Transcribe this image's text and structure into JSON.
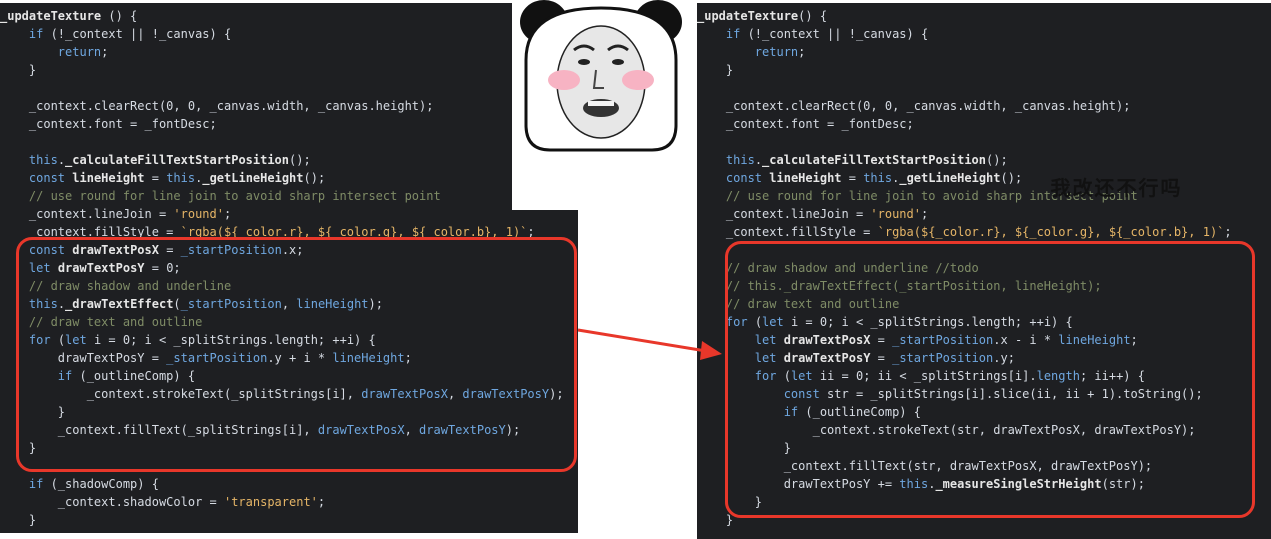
{
  "left_code": {
    "lines": [
      [
        [
          "fn",
          "_updateTexture"
        ],
        [
          "plain",
          " () {"
        ]
      ],
      [
        [
          "plain",
          "    "
        ],
        [
          "kw",
          "if"
        ],
        [
          "plain",
          " (!_context || !_canvas) {"
        ]
      ],
      [
        [
          "plain",
          "        "
        ],
        [
          "kw",
          "return"
        ],
        [
          "plain",
          ";"
        ]
      ],
      [
        [
          "plain",
          "    }"
        ]
      ],
      [
        [
          "plain",
          ""
        ]
      ],
      [
        [
          "plain",
          "    _context.clearRect(0, 0, _canvas.width, _canvas.height);"
        ]
      ],
      [
        [
          "plain",
          "    _context.font = _fontDesc;"
        ]
      ],
      [
        [
          "plain",
          ""
        ]
      ],
      [
        [
          "plain",
          "    "
        ],
        [
          "this",
          "this"
        ],
        [
          "plain",
          "."
        ],
        [
          "fn",
          "_calculateFillTextStartPosition"
        ],
        [
          "plain",
          "();"
        ]
      ],
      [
        [
          "plain",
          "    "
        ],
        [
          "kw",
          "const"
        ],
        [
          "plain",
          " "
        ],
        [
          "fn",
          "lineHeight"
        ],
        [
          "plain",
          " = "
        ],
        [
          "this",
          "this"
        ],
        [
          "plain",
          "."
        ],
        [
          "fn",
          "_getLineHeight"
        ],
        [
          "plain",
          "();"
        ]
      ],
      [
        [
          "cmt",
          "    // use round for line join to avoid sharp intersect point"
        ]
      ],
      [
        [
          "plain",
          "    _context.lineJoin = "
        ],
        [
          "str",
          "'round'"
        ],
        [
          "plain",
          ";"
        ]
      ],
      [
        [
          "plain",
          "    _context.fillStyle = "
        ],
        [
          "str",
          "`rgba(${_color.r}, ${_color.g}, ${_color.b}, 1)`"
        ],
        [
          "plain",
          ";"
        ]
      ],
      [
        [
          "plain",
          "    "
        ],
        [
          "kw",
          "const"
        ],
        [
          "plain",
          " "
        ],
        [
          "fn",
          "drawTextPosX"
        ],
        [
          "plain",
          " = "
        ],
        [
          "kw",
          "_startPosition"
        ],
        [
          "plain",
          ".x;"
        ]
      ],
      [
        [
          "plain",
          "    "
        ],
        [
          "kw",
          "let"
        ],
        [
          "plain",
          " "
        ],
        [
          "fn",
          "drawTextPosY"
        ],
        [
          "plain",
          " = 0;"
        ]
      ],
      [
        [
          "cmt",
          "    // draw shadow and underline"
        ]
      ],
      [
        [
          "plain",
          "    "
        ],
        [
          "this",
          "this"
        ],
        [
          "plain",
          "."
        ],
        [
          "fn",
          "_drawTextEffect"
        ],
        [
          "plain",
          "("
        ],
        [
          "kw",
          "_startPosition"
        ],
        [
          "plain",
          ", "
        ],
        [
          "kw",
          "lineHeight"
        ],
        [
          "plain",
          ");"
        ]
      ],
      [
        [
          "cmt",
          "    // draw text and outline"
        ]
      ],
      [
        [
          "plain",
          "    "
        ],
        [
          "kw",
          "for"
        ],
        [
          "plain",
          " ("
        ],
        [
          "kw",
          "let"
        ],
        [
          "plain",
          " i = 0; i < _splitStrings.length; ++i) {"
        ]
      ],
      [
        [
          "plain",
          "        drawTextPosY = "
        ],
        [
          "kw",
          "_startPosition"
        ],
        [
          "plain",
          ".y + i * "
        ],
        [
          "kw",
          "lineHeight"
        ],
        [
          "plain",
          ";"
        ]
      ],
      [
        [
          "plain",
          "        "
        ],
        [
          "kw",
          "if"
        ],
        [
          "plain",
          " (_outlineComp) {"
        ]
      ],
      [
        [
          "plain",
          "            _context.strokeText(_splitStrings[i], "
        ],
        [
          "kw",
          "drawTextPosX"
        ],
        [
          "plain",
          ", "
        ],
        [
          "kw",
          "drawTextPosY"
        ],
        [
          "plain",
          ");"
        ]
      ],
      [
        [
          "plain",
          "        }"
        ]
      ],
      [
        [
          "plain",
          "        _context.fillText(_splitStrings[i], "
        ],
        [
          "kw",
          "drawTextPosX"
        ],
        [
          "plain",
          ", "
        ],
        [
          "kw",
          "drawTextPosY"
        ],
        [
          "plain",
          ");"
        ]
      ],
      [
        [
          "plain",
          "    }"
        ]
      ],
      [
        [
          "plain",
          ""
        ]
      ],
      [
        [
          "plain",
          "    "
        ],
        [
          "kw",
          "if"
        ],
        [
          "plain",
          " (_shadowComp) {"
        ]
      ],
      [
        [
          "plain",
          "        _context.shadowColor = "
        ],
        [
          "str",
          "'transparent'"
        ],
        [
          "plain",
          ";"
        ]
      ],
      [
        [
          "plain",
          "    }"
        ]
      ]
    ]
  },
  "right_code": {
    "lines": [
      [
        [
          "fn",
          "_updateTexture"
        ],
        [
          "plain",
          "() {"
        ]
      ],
      [
        [
          "plain",
          "    "
        ],
        [
          "kw",
          "if"
        ],
        [
          "plain",
          " (!_context || !_canvas) {"
        ]
      ],
      [
        [
          "plain",
          "        "
        ],
        [
          "kw",
          "return"
        ],
        [
          "plain",
          ";"
        ]
      ],
      [
        [
          "plain",
          "    }"
        ]
      ],
      [
        [
          "plain",
          ""
        ]
      ],
      [
        [
          "plain",
          "    _context.clearRect(0, 0, _canvas.width, _canvas.height);"
        ]
      ],
      [
        [
          "plain",
          "    _context.font = _fontDesc;"
        ]
      ],
      [
        [
          "plain",
          ""
        ]
      ],
      [
        [
          "plain",
          "    "
        ],
        [
          "this",
          "this"
        ],
        [
          "plain",
          "."
        ],
        [
          "fn",
          "_calculateFillTextStartPosition"
        ],
        [
          "plain",
          "();"
        ]
      ],
      [
        [
          "plain",
          "    "
        ],
        [
          "kw",
          "const"
        ],
        [
          "plain",
          " "
        ],
        [
          "fn",
          "lineHeight"
        ],
        [
          "plain",
          " = "
        ],
        [
          "this",
          "this"
        ],
        [
          "plain",
          "."
        ],
        [
          "fn",
          "_getLineHeight"
        ],
        [
          "plain",
          "();"
        ]
      ],
      [
        [
          "cmt",
          "    // use round for line join to avoid sharp intersect point"
        ]
      ],
      [
        [
          "plain",
          "    _context.lineJoin = "
        ],
        [
          "str",
          "'round'"
        ],
        [
          "plain",
          ";"
        ]
      ],
      [
        [
          "plain",
          "    _context.fillStyle = "
        ],
        [
          "str",
          "`rgba(${_color.r}, ${_color.g}, ${_color.b}, 1)`"
        ],
        [
          "plain",
          ";"
        ]
      ],
      [
        [
          "plain",
          ""
        ]
      ],
      [
        [
          "cmt",
          "    // draw shadow and underline //todo"
        ]
      ],
      [
        [
          "cmt",
          "    // this._drawTextEffect(_startPosition, lineHeight);"
        ]
      ],
      [
        [
          "cmt",
          "    // draw text and outline"
        ]
      ],
      [
        [
          "plain",
          "    "
        ],
        [
          "kw",
          "for"
        ],
        [
          "plain",
          " ("
        ],
        [
          "kw",
          "let"
        ],
        [
          "plain",
          " i = 0; i < _splitStrings.length; ++i) {"
        ]
      ],
      [
        [
          "plain",
          "        "
        ],
        [
          "kw",
          "let"
        ],
        [
          "plain",
          " "
        ],
        [
          "fn",
          "drawTextPosX"
        ],
        [
          "plain",
          " = "
        ],
        [
          "kw",
          "_startPosition"
        ],
        [
          "plain",
          ".x - i * "
        ],
        [
          "kw",
          "lineHeight"
        ],
        [
          "plain",
          ";"
        ]
      ],
      [
        [
          "plain",
          "        "
        ],
        [
          "kw",
          "let"
        ],
        [
          "plain",
          " "
        ],
        [
          "fn",
          "drawTextPosY"
        ],
        [
          "plain",
          " = "
        ],
        [
          "kw",
          "_startPosition"
        ],
        [
          "plain",
          ".y;"
        ]
      ],
      [
        [
          "plain",
          "        "
        ],
        [
          "kw",
          "for"
        ],
        [
          "plain",
          " ("
        ],
        [
          "kw",
          "let"
        ],
        [
          "plain",
          " ii = 0; ii < _splitStrings[i]."
        ],
        [
          "kw",
          "length"
        ],
        [
          "plain",
          "; ii++) {"
        ]
      ],
      [
        [
          "plain",
          "            "
        ],
        [
          "kw",
          "const"
        ],
        [
          "plain",
          " str = _splitStrings[i].slice(ii, ii + 1).toString();"
        ]
      ],
      [
        [
          "plain",
          "            "
        ],
        [
          "kw",
          "if"
        ],
        [
          "plain",
          " (_outlineComp) {"
        ]
      ],
      [
        [
          "plain",
          "                _context.strokeText(str, drawTextPosX, drawTextPosY);"
        ]
      ],
      [
        [
          "plain",
          "            }"
        ]
      ],
      [
        [
          "plain",
          "            _context.fillText(str, drawTextPosX, drawTextPosY);"
        ]
      ],
      [
        [
          "plain",
          "            drawTextPosY += "
        ],
        [
          "this",
          "this"
        ],
        [
          "plain",
          "."
        ],
        [
          "fn",
          "_measureSingleStrHeight"
        ],
        [
          "plain",
          "(str);"
        ]
      ],
      [
        [
          "plain",
          "        }"
        ]
      ],
      [
        [
          "plain",
          "    }"
        ]
      ]
    ]
  },
  "meme": {
    "caption": "我改还不行吗",
    "icon": "panda-face-meme"
  },
  "colors": {
    "editor_bg": "#1e1f22",
    "keyword": "#6fa7e0",
    "string": "#e5b567",
    "comment": "#7f8c66",
    "highlight": "#e8372a"
  }
}
